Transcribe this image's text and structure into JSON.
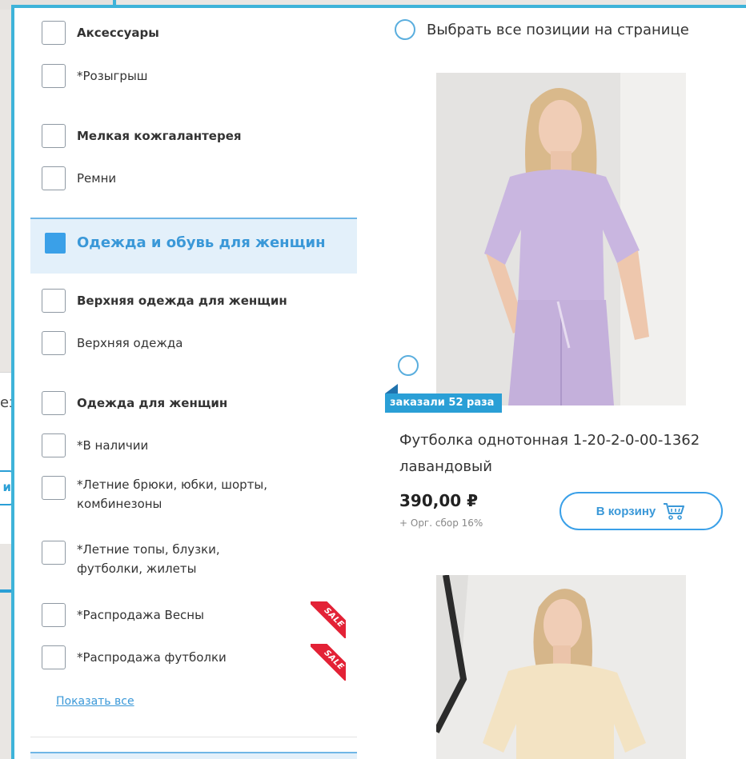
{
  "background": {
    "partial_text": "ез",
    "partial_button": "и"
  },
  "filters": {
    "items": [
      {
        "label": "Аксессуары",
        "bold": true,
        "checked": false
      },
      {
        "label": "*Розыгрыш",
        "bold": false,
        "checked": false
      },
      {
        "label": "Мелкая кожгалантерея",
        "bold": true,
        "checked": false
      },
      {
        "label": "Ремни",
        "bold": false,
        "checked": false
      },
      {
        "label": "Одежда и обувь для женщин",
        "bold": true,
        "checked": true,
        "active": true
      },
      {
        "label": "Верхняя одежда для женщин",
        "bold": true,
        "checked": false
      },
      {
        "label": "Верхняя одежда",
        "bold": false,
        "checked": false
      },
      {
        "label": "Одежда для женщин",
        "bold": true,
        "checked": false
      },
      {
        "label": "*В наличии",
        "bold": false,
        "checked": false
      },
      {
        "label": "*Летние брюки, юбки, шорты, комбинезоны",
        "bold": false,
        "checked": false
      },
      {
        "label": "*Летние топы, блузки, футболки, жилеты",
        "bold": false,
        "checked": false
      },
      {
        "label": "*Распродажа Весны",
        "bold": false,
        "checked": false,
        "sale": true
      },
      {
        "label": "*Распродажа футболки",
        "bold": false,
        "checked": false,
        "sale": true
      }
    ],
    "sale_badge": "SALE",
    "show_all": "Показать все"
  },
  "catalog": {
    "select_all": "Выбрать все позиции на странице",
    "products": [
      {
        "badge": "заказали 52 раза",
        "name": "Футболка однотонная 1-20-2-0-00-1362 лавандовый",
        "price": "390,00 ₽",
        "fee": "+ Орг. сбор 16%",
        "cart_label": "В корзину",
        "color": "#c9b6e0"
      },
      {
        "color": "#f3e3c3"
      }
    ]
  },
  "colors": {
    "accent": "#2a9fd6",
    "frame": "#3eb3d9",
    "active_bg": "#e3f0fa",
    "sale_red": "#e32236"
  },
  "icons": {
    "cart": "shopping-cart-icon"
  }
}
